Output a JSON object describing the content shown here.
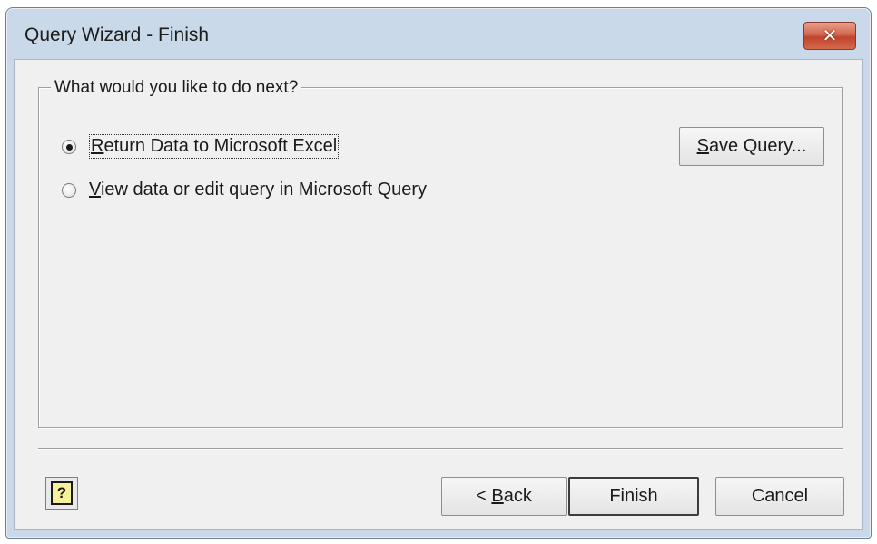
{
  "window": {
    "title": "Query Wizard - Finish",
    "close_glyph": "✕"
  },
  "group": {
    "legend": "What would you like to do next?"
  },
  "options": [
    {
      "label_accesskey": "R",
      "label_rest": "eturn Data to Microsoft Excel",
      "selected": true
    },
    {
      "label_accesskey": "V",
      "label_rest": "iew data or edit query in Microsoft Query",
      "selected": false
    }
  ],
  "buttons": {
    "save_query_accesskey": "S",
    "save_query_rest": "ave Query...",
    "back_prefix": "< ",
    "back_accesskey": "B",
    "back_rest": "ack",
    "finish": "Finish",
    "cancel": "Cancel",
    "help_glyph": "?"
  },
  "colors": {
    "client_bg": "#f0f0f0",
    "frame": "#c9d9ea",
    "close_red": "#c0442c"
  }
}
